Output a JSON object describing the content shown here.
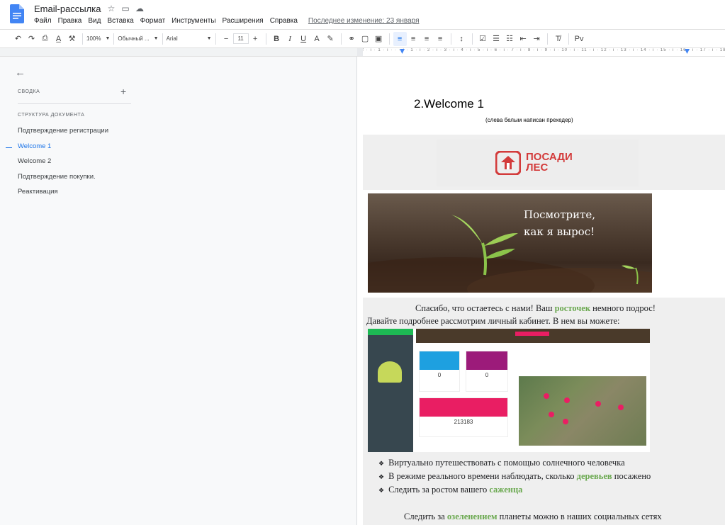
{
  "app": {
    "doc_title": "Email-рассылка",
    "menu": [
      "Файл",
      "Правка",
      "Вид",
      "Вставка",
      "Формат",
      "Инструменты",
      "Расширения",
      "Справка"
    ],
    "last_edit": "Последнее изменение: 23 января"
  },
  "toolbar": {
    "zoom": "100%",
    "style": "Обычный ...",
    "font": "Arial",
    "font_size": "11",
    "minus": "−",
    "plus": "+"
  },
  "ruler": {
    "text": "· 2 · ı · 1 · ı · · · ı · 1 · ı · 2 · ı · 3 · ı · 4 · ı · 5 · ı · 6 · ı · 7 · ı · 8 · ı · 9 · ı · 10 · ı · 11 · ı · 12 · ı · 13 · ı · 14 · ı · 15 · ı · 16 · ı · 17 · ı · 18"
  },
  "sidebar": {
    "summary_header": "СВОДКА",
    "structure_header": "СТРУКТУРА ДОКУМЕНТА",
    "items": [
      {
        "label": "Подтверждение регистрации",
        "active": false
      },
      {
        "label": "Welcome 1",
        "active": true
      },
      {
        "label": "Welcome 2",
        "active": false
      },
      {
        "label": "Подтверждение покупки.",
        "active": false
      },
      {
        "label": "Реактивация",
        "active": false
      }
    ]
  },
  "document": {
    "heading": "2.Welcome 1",
    "note": "(слева белым написан прехедер)",
    "logo_line1": "ПОСАДИ",
    "logo_line2": "ЛЕС",
    "hero_line1": "Посмотрите,",
    "hero_line2": "как я вырос!",
    "p1_a": "Спасибо, что остаетесь с нами! Ваш ",
    "p1_hl": "росточек",
    "p1_b": " немного подрос!",
    "p2": "Давайте подробнее рассмотрим личный кабинет. В нем вы можете:",
    "dash_num1": "0",
    "dash_num2": "0",
    "dash_num3": "213183",
    "bullets": [
      {
        "a": "Виртуально путешествовать с помощью солнечного человечка",
        "hl": "",
        "b": ""
      },
      {
        "a": "В режиме реального времени наблюдать, сколько ",
        "hl": "деревьев",
        "b": " посажено"
      },
      {
        "a": "Следить за ростом вашего ",
        "hl": "саженца",
        "b": ""
      }
    ],
    "footer_a": "Следить за ",
    "footer_hl": "озеленением",
    "footer_b": " планеты можно в наших социальных сетях"
  },
  "colors": {
    "accent": "#1a73e8",
    "highlight": "#6aa84f",
    "brand_red": "#d33b3b"
  }
}
